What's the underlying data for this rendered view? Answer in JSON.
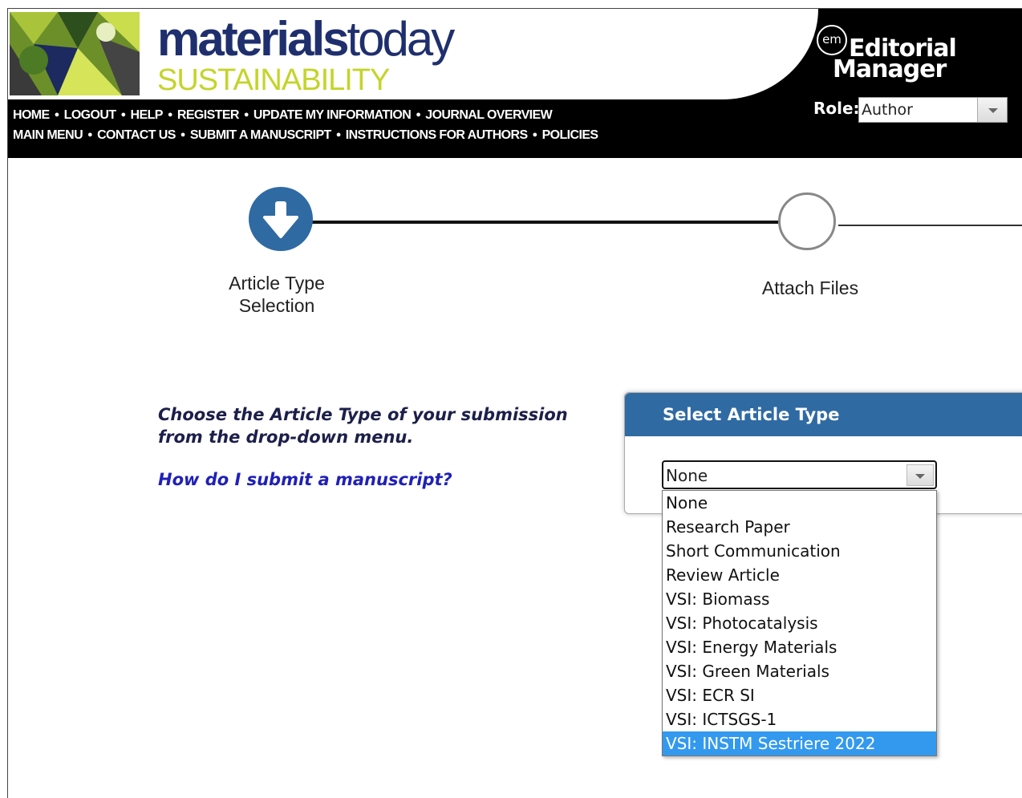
{
  "header": {
    "brand_main_bold": "materials",
    "brand_main_light": "today",
    "brand_sub": "SUSTAINABILITY",
    "em_badge": "em",
    "em_line1": "Editorial",
    "em_line2": "Manager",
    "role_label": "Role:",
    "role_value": "Author",
    "nav_row1": [
      "HOME",
      "LOGOUT",
      "HELP",
      "REGISTER",
      "UPDATE MY INFORMATION",
      "JOURNAL OVERVIEW"
    ],
    "nav_row2": [
      "MAIN MENU",
      "CONTACT US",
      "SUBMIT A MANUSCRIPT",
      "INSTRUCTIONS FOR AUTHORS",
      "POLICIES"
    ]
  },
  "progress": {
    "steps": [
      {
        "line1": "Article Type",
        "line2": "Selection",
        "state": "current"
      },
      {
        "line1": "Attach Files",
        "line2": "",
        "state": "pending"
      }
    ]
  },
  "instructions": {
    "line1": "Choose the Article Type of your submission",
    "line2": "from the drop-down menu.",
    "help_link": "How do I submit a manuscript?"
  },
  "article_panel": {
    "title": "Select Article Type",
    "selected_value": "None",
    "options": [
      "None",
      "Research Paper",
      "Short Communication",
      "Review Article",
      "VSI: Biomass",
      "VSI: Photocatalysis",
      "VSI: Energy Materials",
      "VSI: Green Materials",
      "VSI: ECR SI",
      "VSI: ICTSGS-1",
      "VSI: INSTM Sestriere 2022"
    ],
    "highlighted_option": "VSI: INSTM Sestriere 2022"
  },
  "colors": {
    "accent_blue": "#2f6aa3",
    "highlight_blue": "#3399ee",
    "brand_navy": "#1f2f6e",
    "brand_lime": "#c4d42a",
    "link_blue": "#2020b8"
  }
}
